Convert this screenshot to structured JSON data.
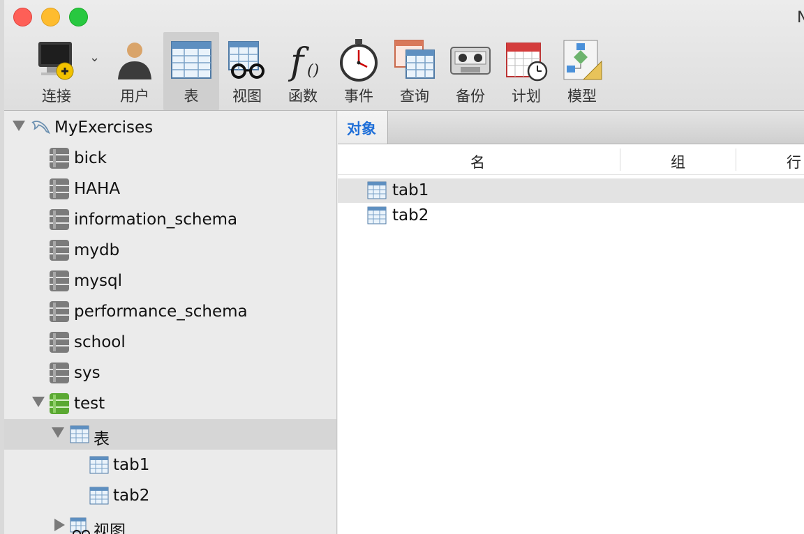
{
  "window": {
    "title_fragment": "N"
  },
  "toolbar": {
    "items": [
      {
        "label": "连接",
        "icon": "connection-icon"
      },
      {
        "label": "用户",
        "icon": "user-icon"
      },
      {
        "label": "表",
        "icon": "table-icon",
        "active": true
      },
      {
        "label": "视图",
        "icon": "view-icon"
      },
      {
        "label": "函数",
        "icon": "function-icon"
      },
      {
        "label": "事件",
        "icon": "event-stopwatch-icon"
      },
      {
        "label": "查询",
        "icon": "query-icon"
      },
      {
        "label": "备份",
        "icon": "backup-cassette-icon"
      },
      {
        "label": "计划",
        "icon": "schedule-calendar-icon"
      },
      {
        "label": "模型",
        "icon": "model-diagram-icon"
      }
    ]
  },
  "sidebar": {
    "connection": "MyExercises",
    "databases": [
      "bick",
      "HAHA",
      "information_schema",
      "mydb",
      "mysql",
      "performance_schema",
      "school",
      "sys",
      "test"
    ],
    "test_children": {
      "tables_label": "表",
      "tables": [
        "tab1",
        "tab2"
      ],
      "views_label": "视图"
    }
  },
  "main": {
    "tab_label": "对象",
    "columns": [
      "名",
      "组",
      "行"
    ],
    "rows": [
      "tab1",
      "tab2"
    ]
  },
  "colors": {
    "accent": "#1f6fd8",
    "db_gray": "#7b7b7b",
    "db_green": "#5aa832"
  }
}
